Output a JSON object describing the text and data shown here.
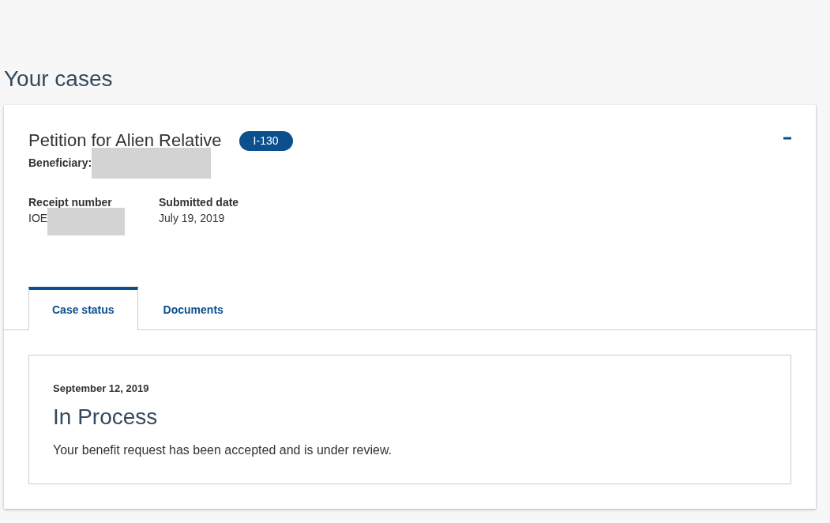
{
  "heading": "Your cases",
  "case": {
    "title": "Petition for Alien Relative",
    "form_badge": "I-130",
    "expanded": true,
    "beneficiary": {
      "label": "Beneficiary:",
      "redacted": true
    },
    "fields": [
      {
        "label": "Receipt number",
        "value": "IOE",
        "redacted": true
      },
      {
        "label": "Submitted date",
        "value": "July 19, 2019",
        "redacted": false
      }
    ],
    "tabs": [
      {
        "label": "Case status",
        "selected": true
      },
      {
        "label": "Documents",
        "selected": false
      }
    ],
    "status": {
      "date": "September 12, 2019",
      "title": "In Process",
      "description": "Your benefit request has been accepted and is under review."
    }
  }
}
